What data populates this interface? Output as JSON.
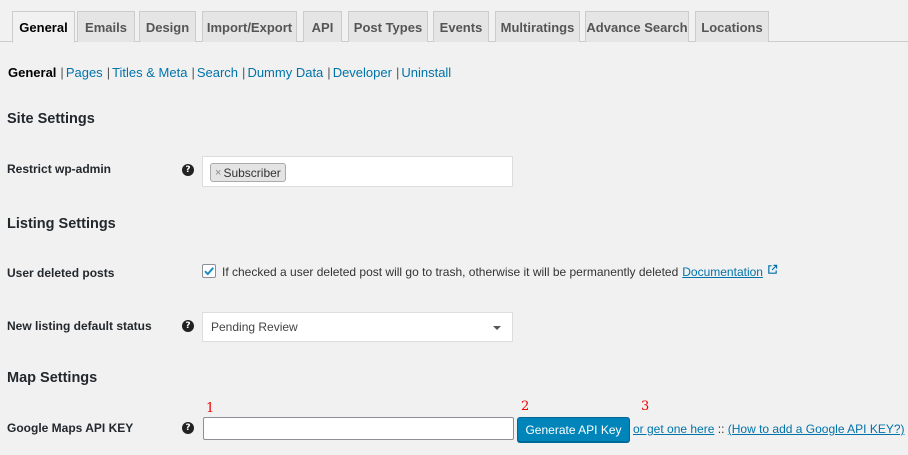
{
  "tabs": [
    {
      "label": "General",
      "active": true
    },
    {
      "label": "Emails"
    },
    {
      "label": "Design"
    },
    {
      "label": "Import/Export"
    },
    {
      "label": "API"
    },
    {
      "label": "Post Types"
    },
    {
      "label": "Events"
    },
    {
      "label": "Multiratings"
    },
    {
      "label": "Advance Search"
    },
    {
      "label": "Locations"
    }
  ],
  "subnav": {
    "current": "General",
    "separator": "|",
    "links": [
      "Pages",
      "Titles & Meta",
      "Search",
      "Dummy Data",
      "Developer",
      "Uninstall"
    ]
  },
  "sections": {
    "site": "Site Settings",
    "listing": "Listing Settings",
    "map": "Map Settings"
  },
  "fields": {
    "restrict_admin": {
      "label": "Restrict wp-admin",
      "tag": "Subscriber",
      "remove_glyph": "×"
    },
    "user_deleted": {
      "label": "User deleted posts",
      "checked": true,
      "description": "If checked a user deleted post will go to trash, otherwise it will be permanently deleted",
      "doc_link": "Documentation"
    },
    "default_status": {
      "label": "New listing default status",
      "value": "Pending Review"
    },
    "maps_api_key": {
      "label": "Google Maps API KEY",
      "value": "",
      "button": "Generate API Key",
      "or_text": "or get one here",
      "separator": " :: ",
      "help_link": "(How to add a Google API KEY?)"
    }
  },
  "help_glyph": "?",
  "annotations": [
    "1",
    "2",
    "3"
  ],
  "colors": {
    "link": "#0073aa",
    "primary_button": "#0085ba",
    "annotation": "#e00000",
    "background": "#f1f1f1"
  }
}
